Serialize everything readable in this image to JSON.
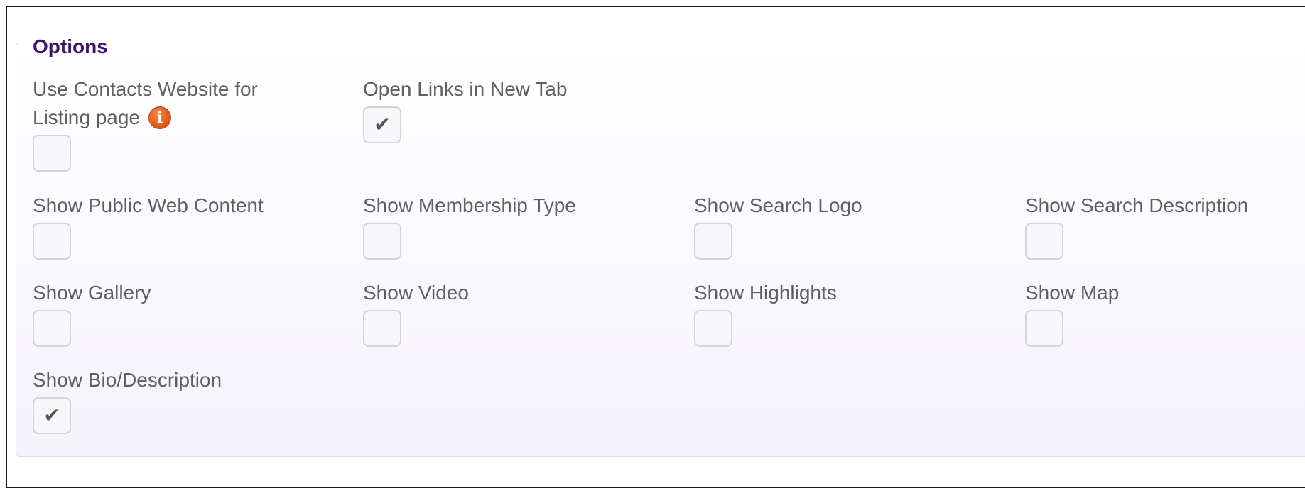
{
  "options": {
    "legend": "Options",
    "items": [
      {
        "label": "Use Contacts Website for Listing page",
        "checked": false,
        "has_info": true,
        "check_glyph": ""
      },
      {
        "label": "Open Links in New Tab",
        "checked": true,
        "check_glyph": "✔"
      },
      {
        "label": "Show Public Web Content",
        "checked": false,
        "check_glyph": ""
      },
      {
        "label": "Show Membership Type",
        "checked": false,
        "check_glyph": ""
      },
      {
        "label": "Show Search Logo",
        "checked": false,
        "check_glyph": ""
      },
      {
        "label": "Show Search Description",
        "checked": false,
        "check_glyph": ""
      },
      {
        "label": "Show Gallery",
        "checked": false,
        "check_glyph": ""
      },
      {
        "label": "Show Video",
        "checked": false,
        "check_glyph": ""
      },
      {
        "label": "Show Highlights",
        "checked": false,
        "check_glyph": ""
      },
      {
        "label": "Show Map",
        "checked": false,
        "check_glyph": ""
      },
      {
        "label": "Show Bio/Description",
        "checked": true,
        "check_glyph": "✔"
      }
    ],
    "info_icon_glyph": "i"
  },
  "colors": {
    "legend": "#3f1567",
    "label": "#5f5f5f",
    "info_icon": "#d9541a"
  }
}
